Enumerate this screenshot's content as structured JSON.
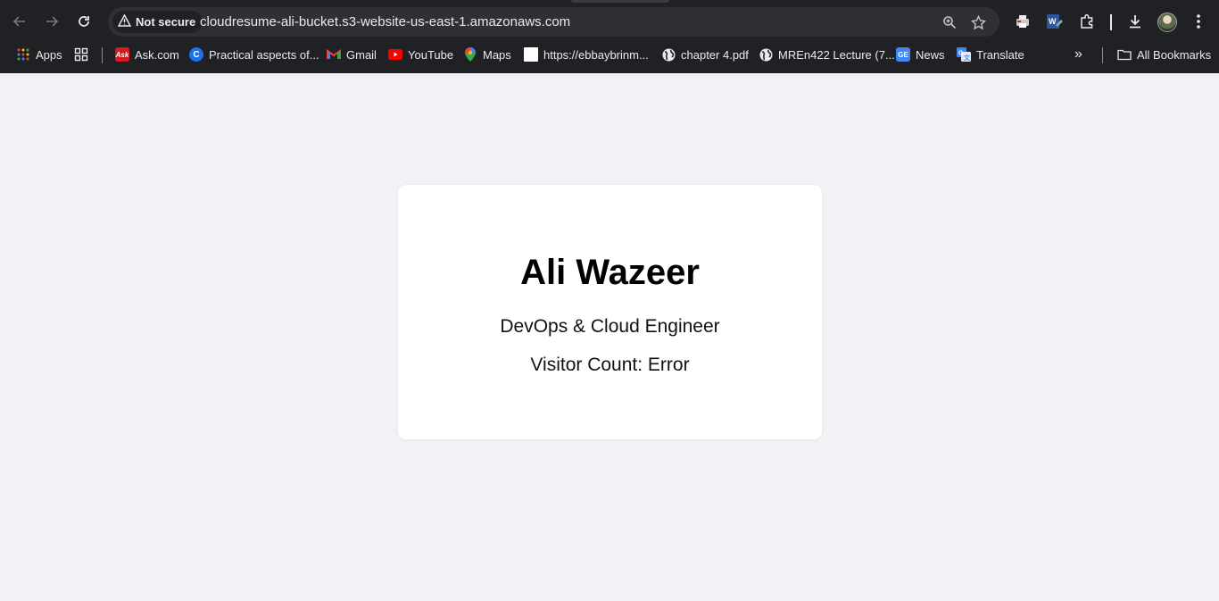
{
  "browser": {
    "security_label": "Not secure",
    "url": "cloudresume-ali-bucket.s3-website-us-east-1.amazonaws.com",
    "icons": {
      "back": "back-arrow-icon",
      "forward": "forward-arrow-icon",
      "reload": "reload-icon",
      "warning": "warning-triangle-icon",
      "zoom": "zoom-icon",
      "bookmark": "star-icon",
      "extensions": "puzzle-icon",
      "download": "download-icon",
      "menu": "kebab-menu-icon"
    }
  },
  "bookmarks": {
    "items": [
      {
        "label": "Apps",
        "icon": "apps-grid-icon"
      },
      {
        "label": "",
        "icon": "tab-grid-icon"
      },
      {
        "label": "Ask.com",
        "icon": "ask-icon"
      },
      {
        "label": "Practical aspects of...",
        "icon": "c-icon"
      },
      {
        "label": "Gmail",
        "icon": "gmail-icon"
      },
      {
        "label": "YouTube",
        "icon": "youtube-icon"
      },
      {
        "label": "Maps",
        "icon": "maps-pin-icon"
      },
      {
        "label": "https://ebbaybrinm...",
        "icon": "blank-page-icon"
      },
      {
        "label": "chapter 4.pdf",
        "icon": "globe-icon"
      },
      {
        "label": "MREn422 Lecture (7...",
        "icon": "globe-icon"
      },
      {
        "label": "News",
        "icon": "news-icon"
      },
      {
        "label": "Translate",
        "icon": "translate-icon"
      }
    ],
    "overflow": "»",
    "all_bookmarks": "All Bookmarks"
  },
  "colors": {
    "chrome_bg": "#202124",
    "omnibox_bg": "#2f3033",
    "page_bg": "#f0f2f5",
    "card_bg": "#ffffff"
  },
  "page": {
    "name": "Ali Wazeer",
    "role": "DevOps & Cloud Engineer",
    "visitor_count": "Visitor Count: Error"
  }
}
